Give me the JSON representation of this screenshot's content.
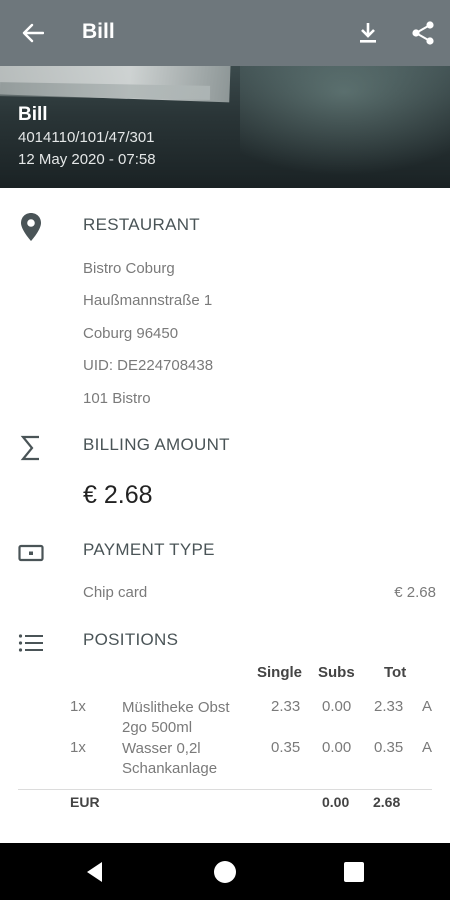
{
  "appbar": {
    "title": "Bill",
    "icons": [
      "back-arrow-icon",
      "download-icon",
      "share-icon"
    ]
  },
  "hero": {
    "title": "Bill",
    "receipt_number": "4014110/101/47/301",
    "datetime": "12 May 2020 - 07:58"
  },
  "restaurant": {
    "heading": "RESTAURANT",
    "lines": [
      "Bistro Coburg",
      "Haußmannstraße 1",
      "Coburg 96450",
      "UID: DE224708438",
      "101 Bistro"
    ]
  },
  "billing": {
    "heading": "BILLING AMOUNT",
    "amount": "€ 2.68"
  },
  "payment": {
    "heading": "PAYMENT TYPE",
    "method": "Chip card",
    "amount": "€ 2.68"
  },
  "positions": {
    "heading": "POSITIONS",
    "columns": {
      "single": "Single",
      "subs": "Subs",
      "tot": "Tot"
    },
    "items": [
      {
        "qty": "1x",
        "name": "Müslitheke Obst 2go 500ml",
        "single": "2.33",
        "subs": "0.00",
        "tot": "2.33",
        "tax": "A"
      },
      {
        "qty": "1x",
        "name": "Wasser 0,2l Schankanlage",
        "single": "0.35",
        "subs": "0.00",
        "tot": "0.35",
        "tax": "A"
      }
    ],
    "footer": {
      "currency": "EUR",
      "subs": "0.00",
      "tot": "2.68"
    }
  },
  "colors": {
    "appbar": "#6e777c",
    "heading": "#4a5457",
    "text_secondary": "#7a7a7a",
    "navbar": "#000000"
  }
}
